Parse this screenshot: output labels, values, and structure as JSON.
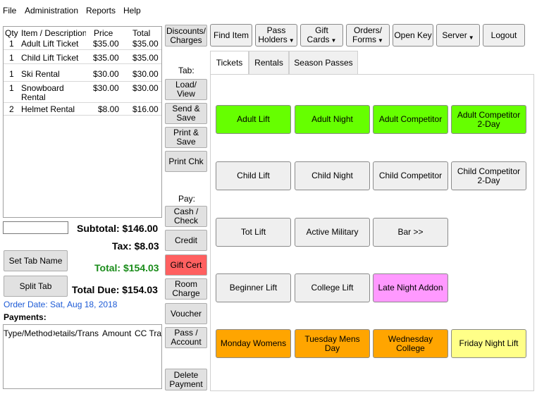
{
  "menu": [
    "File",
    "Administration",
    "Reports",
    "Help"
  ],
  "order_table": {
    "headers": [
      "Qty",
      "Item / Description",
      "Price",
      "Total"
    ],
    "rows": [
      {
        "qty": "1",
        "desc": "Adult Lift Ticket",
        "price": "$35.00",
        "total": "$35.00"
      },
      {
        "qty": "1",
        "desc": "Child Lift Ticket",
        "price": "$35.00",
        "total": "$35.00"
      },
      {
        "qty": "1",
        "desc": "Ski Rental",
        "price": "$30.00",
        "total": "$30.00"
      },
      {
        "qty": "1",
        "desc": "Snowboard Rental",
        "price": "$30.00",
        "total": "$30.00"
      },
      {
        "qty": "2",
        "desc": "Helmet Rental",
        "price": "$8.00",
        "total": "$16.00"
      }
    ]
  },
  "totals": {
    "subtotal": "Subtotal: $146.00",
    "tax": "Tax: $8.03",
    "total": "Total: $154.03",
    "total_due": "Total Due: $154.03",
    "total_color": "#1a8c1a"
  },
  "left_buttons": {
    "set_tab_name": "Set Tab Name",
    "split_tab": "Split Tab"
  },
  "order_date": "Order Date: Sat, Aug 18, 2018",
  "payments": {
    "label": "Payments:",
    "headers": [
      "Type/Method",
      "Details/Trans",
      "Amount",
      "CC Trans"
    ]
  },
  "middle": {
    "discounts": "Discounts/ Charges",
    "tab_label": "Tab:",
    "load_view": "Load/ View",
    "send_save": "Send & Save",
    "print_save": "Print & Save",
    "print_chk": "Print Chk",
    "pay_label": "Pay:",
    "cash_check": "Cash / Check",
    "credit": "Credit",
    "gift_cert": "Gift Cert",
    "room_charge": "Room Charge",
    "voucher": "Voucher",
    "pass_account": "Pass / Account",
    "delete_payment": "Delete Payment",
    "gift_cert_color": "#ff6060"
  },
  "toolbar": {
    "find_item": "Find Item",
    "pass_holders": "Pass Holders",
    "gift_cards": "Gift Cards",
    "orders_forms": "Orders/ Forms",
    "open_key": "Open Key",
    "server": "Server",
    "logout": "Logout"
  },
  "tabs": [
    "Tickets",
    "Rentals",
    "Season Passes"
  ],
  "items": [
    {
      "label": "Adult Lift",
      "color": "green"
    },
    {
      "label": "Adult Night",
      "color": "green"
    },
    {
      "label": "Adult Competitor",
      "color": "green"
    },
    {
      "label": "Adult Competitor 2-Day",
      "color": "green"
    },
    {
      "label": "Child Lift",
      "color": "gray"
    },
    {
      "label": "Child Night",
      "color": "gray"
    },
    {
      "label": "Child Competitor",
      "color": "gray"
    },
    {
      "label": "Child Competitor 2-Day",
      "color": "gray"
    },
    {
      "label": "Tot Lift",
      "color": "gray"
    },
    {
      "label": "Active Military",
      "color": "gray"
    },
    {
      "label": "Bar >>",
      "color": "gray"
    },
    {
      "label": "Beginner Lift",
      "color": "gray"
    },
    {
      "label": "College Lift",
      "color": "gray"
    },
    {
      "label": "Late Night Addon",
      "color": "pink"
    },
    {
      "label": "Monday Womens",
      "color": "orange"
    },
    {
      "label": "Tuesday Mens Day",
      "color": "orange"
    },
    {
      "label": "Wednesday College",
      "color": "orange"
    },
    {
      "label": "Friday Night Lift",
      "color": "yellow"
    }
  ]
}
